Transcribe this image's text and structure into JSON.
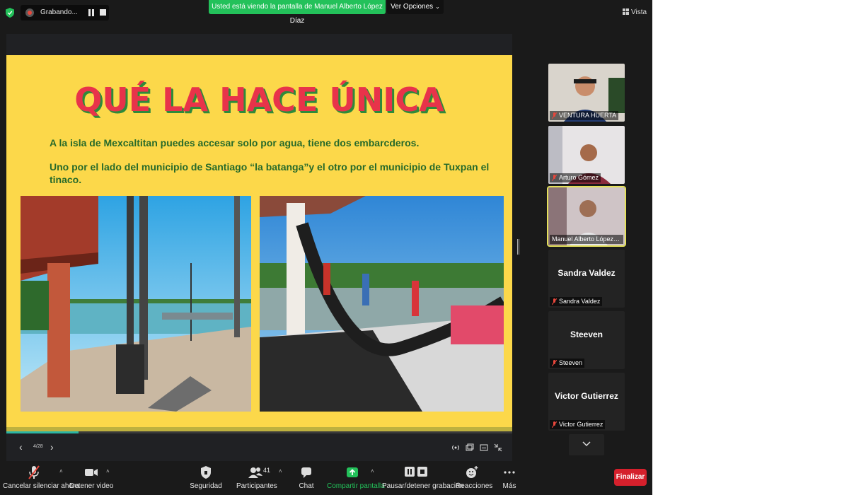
{
  "topbar": {
    "recording_label": "Grabando...",
    "share_banner": "Usted está viendo la pantalla de Manuel Alberto López Díaz",
    "view_options_label": "Ver Opciones",
    "vista_label": "Vista"
  },
  "slide": {
    "title": "QUÉ LA HACE ÚNICA",
    "paragraph1": "A la isla de Mexcaltitan puedes accesar solo por agua, tiene dos embarcderos.",
    "paragraph2": "Uno por el lado del municipio de Santiago “la batanga”y el otro por el municipio de Tuxpan el tinaco.",
    "page_indicator": "4/28",
    "progress_fraction": 0.143
  },
  "participants": [
    {
      "name": "VENTURA HUERTA",
      "video": true
    },
    {
      "name": "Arturo Gómez",
      "video": true
    },
    {
      "name": "Manuel Alberto López D...",
      "video": true,
      "active": true
    },
    {
      "name": "Sandra Valdez",
      "video": false
    },
    {
      "name": "Steeven",
      "video": false
    },
    {
      "name": "Victor Gutierrez",
      "video": false
    }
  ],
  "toolbar": {
    "unmute_label": "Cancelar silenciar ahora",
    "stop_video_label": "Detener video",
    "security_label": "Seguridad",
    "participants_label": "Participantes",
    "participants_count": "41",
    "chat_label": "Chat",
    "share_label": "Compartir pantalla",
    "record_label": "Pausar/detener grabación",
    "reactions_label": "Reacciones",
    "more_label": "Más",
    "end_label": "Finalizar"
  },
  "colors": {
    "share_green": "#23c15a",
    "slide_yellow": "#fcd84a",
    "title_red": "#e8334a",
    "text_green": "#276a2a",
    "end_red": "#d5202c",
    "active_speaker": "#e3e05a"
  }
}
